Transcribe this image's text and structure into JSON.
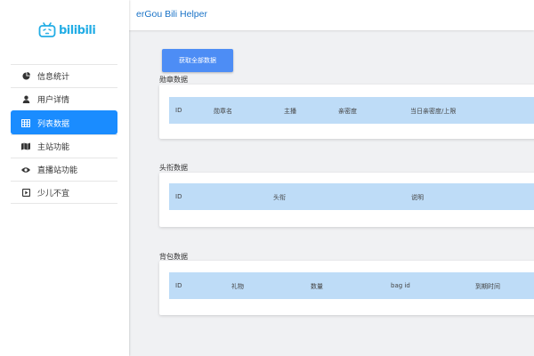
{
  "app": {
    "logo_text": "bilibili",
    "title": "erGou Bili Helper"
  },
  "sidebar": {
    "items": [
      {
        "label": "信息统计",
        "icon": "pie-chart-icon",
        "active": false
      },
      {
        "label": "用户详情",
        "icon": "user-icon",
        "active": false
      },
      {
        "label": "列表数据",
        "icon": "table-icon",
        "active": true
      },
      {
        "label": "主站功能",
        "icon": "map-icon",
        "active": false
      },
      {
        "label": "直播站功能",
        "icon": "eye-icon",
        "active": false
      },
      {
        "label": "少儿不宜",
        "icon": "play-square-icon",
        "active": false
      }
    ]
  },
  "main": {
    "fetch_button": "获取全部数据",
    "sections": [
      {
        "title": "勋章数据",
        "columns": [
          "ID",
          "勋章名",
          "主播",
          "亲密度",
          "当日亲密度/上限"
        ]
      },
      {
        "title": "头衔数据",
        "columns": [
          "ID",
          "头衔",
          "说明"
        ]
      },
      {
        "title": "背包数据",
        "columns": [
          "ID",
          "礼物",
          "数量",
          "bag id",
          "到期时间"
        ]
      }
    ]
  },
  "colors": {
    "accent": "#1a8cff",
    "button": "#4d8df5",
    "table_header": "#bedcf7",
    "logo": "#23ade5",
    "title": "#1a73c7"
  }
}
